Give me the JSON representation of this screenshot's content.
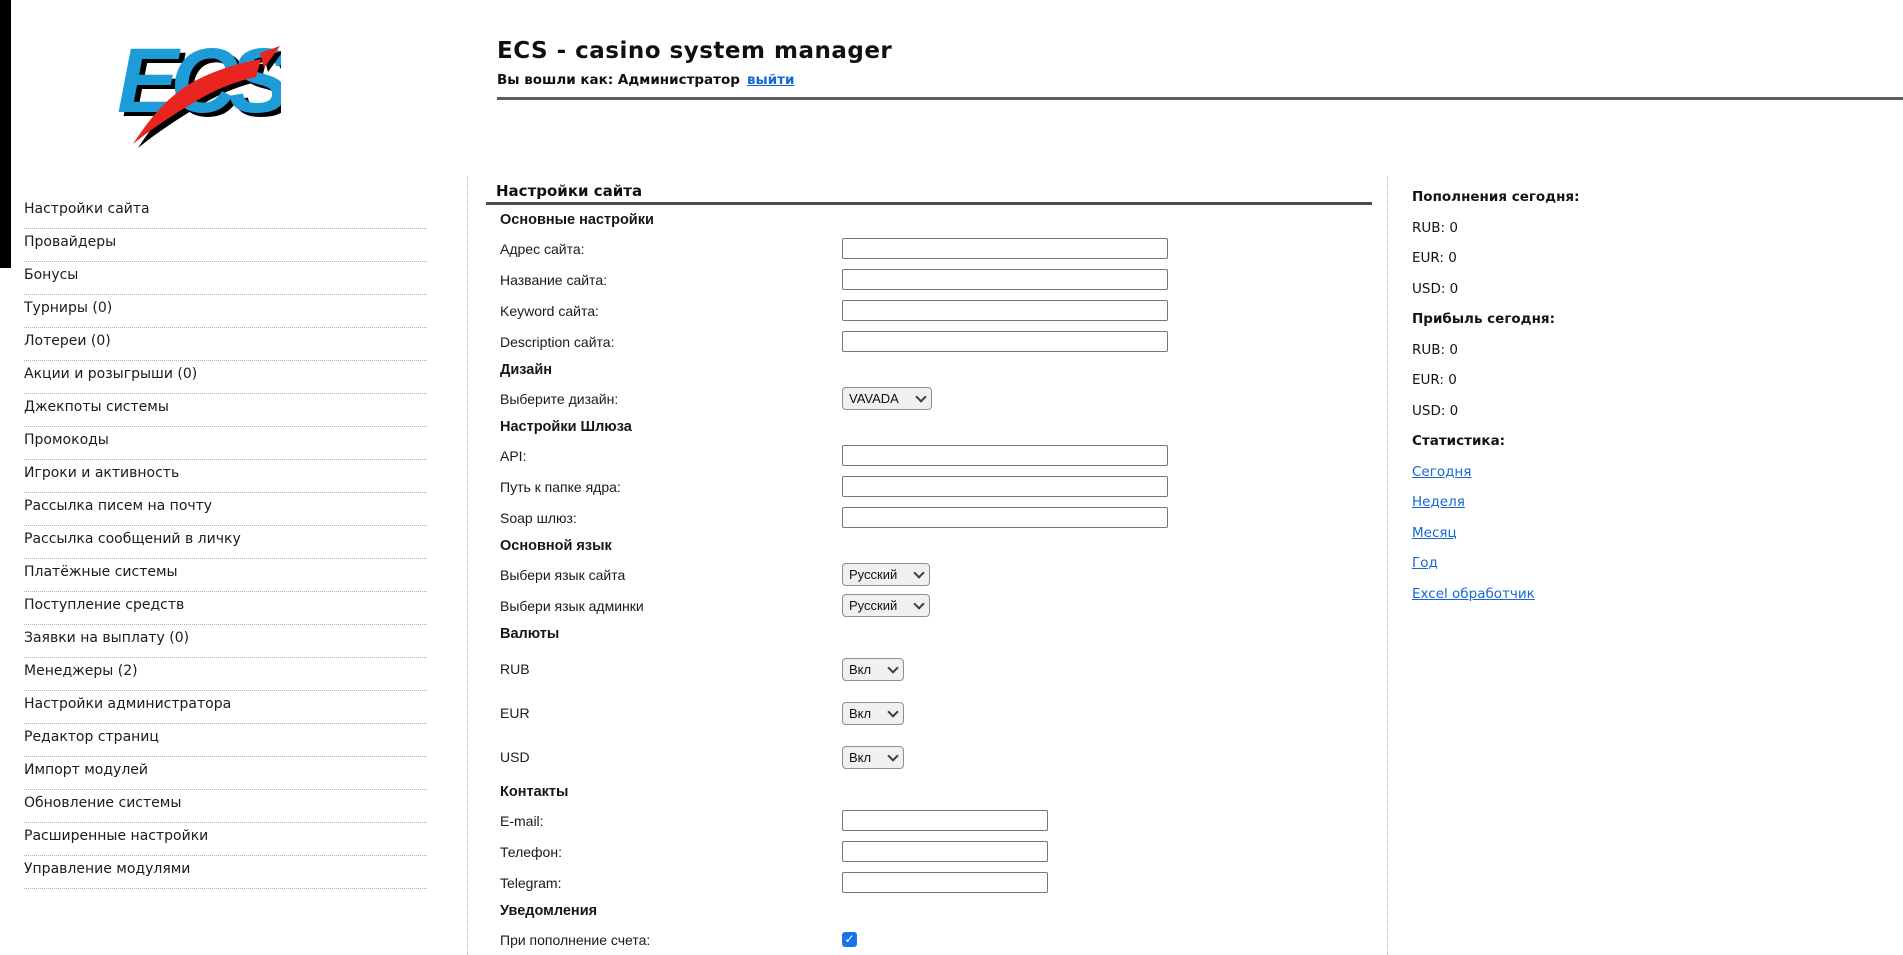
{
  "header": {
    "logo_text": "ECS",
    "title": "ECS - casino system manager",
    "login_prefix": "Вы вошли как: Администратор",
    "logout_link": "выйти"
  },
  "sidebar": {
    "items": [
      "Настройки сайта",
      "Провайдеры",
      "Бонусы",
      "Турниры (0)",
      "Лотереи (0)",
      "Акции и розыгрыши (0)",
      "Джекпоты системы",
      "Промокоды",
      "Игроки и активность",
      "Рассылка писем на почту",
      "Рассылка сообщений в личку",
      "Платёжные системы",
      "Поступление средств",
      "Заявки на выплату (0)",
      "Менеджеры (2)",
      "Настройки администратора",
      "Редактор страниц",
      "Импорт модулей",
      "Обновление системы",
      "Расширенные настройки",
      "Управление модулями"
    ]
  },
  "main": {
    "heading": "Настройки сайта",
    "rows": [
      {
        "type": "section",
        "label": "Основные настройки"
      },
      {
        "type": "text-wide",
        "label": "Адрес сайта:",
        "value": "",
        "placeholder": ""
      },
      {
        "type": "text-wide",
        "label": "Название сайта:",
        "value": "",
        "placeholder": ""
      },
      {
        "type": "text-wide",
        "label": "Keyword сайта:",
        "value": "",
        "placeholder": ""
      },
      {
        "type": "text-wide",
        "label": "Description сайта:",
        "value": "",
        "placeholder": ""
      },
      {
        "type": "section",
        "label": "Дизайн"
      },
      {
        "type": "select-design",
        "label": "Выберите дизайн:",
        "value": "VAVADA"
      },
      {
        "type": "section",
        "label": "Настройки Шлюза"
      },
      {
        "type": "text-wide",
        "label": "API:",
        "value": "",
        "placeholder": ""
      },
      {
        "type": "text-wide",
        "label": "Путь к папке ядра:",
        "value": "",
        "placeholder": ""
      },
      {
        "type": "text-wide",
        "label": "Soap шлюз:",
        "value": "",
        "placeholder": ""
      },
      {
        "type": "section",
        "label": "Основной язык"
      },
      {
        "type": "select-lang",
        "label": "Выбери язык сайта",
        "value": "Русский"
      },
      {
        "type": "select-lang",
        "label": "Выбери язык админки",
        "value": "Русский"
      },
      {
        "type": "section",
        "label": "Валюты"
      },
      {
        "type": "select-onoff",
        "label": "RUB",
        "value": "Вкл"
      },
      {
        "type": "select-onoff",
        "label": "EUR",
        "value": "Вкл"
      },
      {
        "type": "select-onoff",
        "label": "USD",
        "value": "Вкл"
      },
      {
        "type": "section",
        "label": "Контакты"
      },
      {
        "type": "text-narrow",
        "label": "E-mail:",
        "value": "",
        "placeholder": ""
      },
      {
        "type": "text-narrow",
        "label": "Телефон:",
        "value": "",
        "placeholder": ""
      },
      {
        "type": "text-narrow",
        "label": "Telegram:",
        "value": "",
        "placeholder": ""
      },
      {
        "type": "section",
        "label": "Уведомления"
      },
      {
        "type": "checkbox",
        "label": "При пополнение счета:",
        "checked": true
      }
    ]
  },
  "right_panel": {
    "blocks": [
      {
        "title": "Пополнения сегодня:",
        "lines": [
          "RUB: 0",
          "EUR: 0",
          "USD: 0"
        ]
      },
      {
        "title": "Прибыль сегодня:",
        "lines": [
          "RUB: 0",
          "EUR: 0",
          "USD: 0"
        ]
      },
      {
        "title": "Статистика:",
        "links": [
          "Сегодня",
          "Неделя",
          "Месяц",
          "Год",
          "Excel обработчик"
        ]
      }
    ]
  },
  "colors": {
    "link": "#1667d3",
    "checkbox": "#1a73e8",
    "logo_blue": "#1e9cd7",
    "logo_red": "#e8251f",
    "rule": "#5b5c60"
  }
}
